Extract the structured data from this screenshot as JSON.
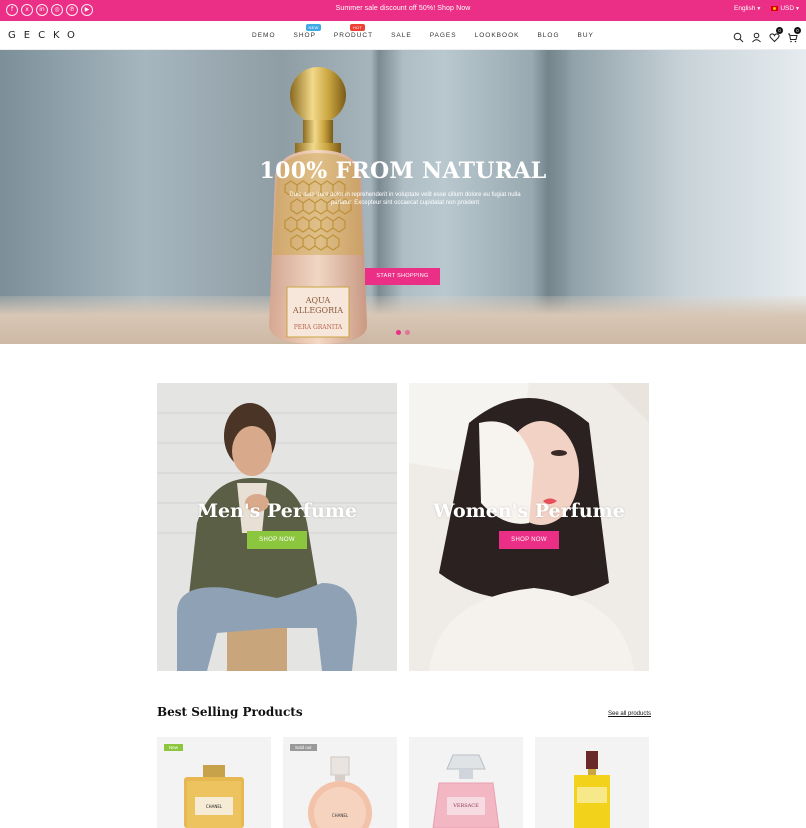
{
  "topbar": {
    "socials": [
      "f",
      "x",
      "in",
      "◎",
      "℗",
      "▶"
    ],
    "promo": "Summer sale discount off 50%! Shop Now",
    "language": "English",
    "currency": "USD"
  },
  "header": {
    "logo": "GECKO",
    "nav": [
      {
        "label": "DEMO"
      },
      {
        "label": "SHOP",
        "tag": "NEW"
      },
      {
        "label": "PRODUCT",
        "tag": "HOT"
      },
      {
        "label": "SALE"
      },
      {
        "label": "PAGES"
      },
      {
        "label": "LOOKBOOK"
      },
      {
        "label": "BLOG"
      },
      {
        "label": "BUY"
      }
    ],
    "wishlist_count": "0",
    "cart_count": "0"
  },
  "hero": {
    "title": "100% FROM NATURAL",
    "subtitle": "Duis aute irure dolor in reprehenderit in voluptate velit esse cillum dolore eu fugiat nulla pariatur. Excepteur sint occaecat cupidatat non proident",
    "button": "START SHOPPING",
    "bottle_label_1": "AQUA",
    "bottle_label_2": "ALLEGORIA",
    "bottle_label_3": "PERA GRANITA"
  },
  "categories": {
    "men": {
      "title": "Men's Perfume",
      "button": "SHOP NOW"
    },
    "women": {
      "title": "Women's Perfume",
      "button": "SHOP NOW"
    }
  },
  "best_selling": {
    "title": "Best Selling Products",
    "see_all": "See all products",
    "products": [
      {
        "label": "New",
        "brand": "CHANEL"
      },
      {
        "label": "Sold out",
        "brand": "CHANEL"
      },
      {
        "label": "",
        "brand": "VERSACE"
      },
      {
        "label": "",
        "brand": ""
      }
    ]
  },
  "colors": {
    "accent": "#ec2f86",
    "green": "#8cc63e"
  }
}
